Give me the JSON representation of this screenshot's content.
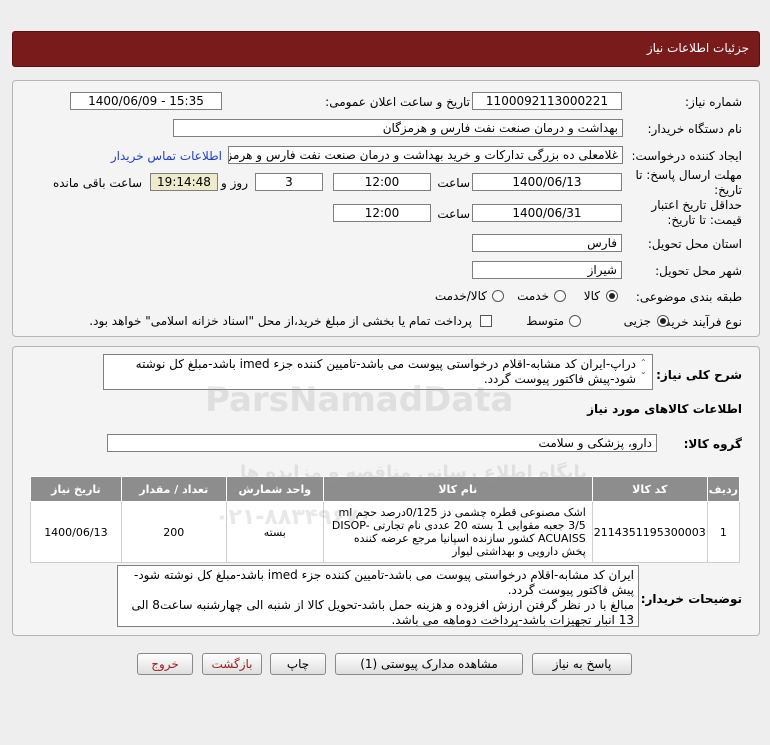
{
  "header": {
    "title": "جزئیات اطلاعات نیاز"
  },
  "form": {
    "need_number_label": "شماره نیاز:",
    "need_number": "1100092113000221",
    "announce_label": "تاریخ و ساعت اعلان عمومی:",
    "announce_value": "1400/06/09 - 15:35",
    "buyer_org_label": "نام دستگاه خریدار:",
    "buyer_org": "بهداشت و درمان صنعت نفت فارس و هرمزگان",
    "creator_label": "ایجاد کننده درخواست:",
    "creator": "غلامعلی ده بزرگی تدارکات و خرید بهداشت و درمان صنعت نفت فارس و هرمزگان",
    "contact_link": "اطلاعات تماس خریدار",
    "deadline_label": "مهلت ارسال پاسخ: تا تاریخ:",
    "deadline_date": "1400/06/13",
    "time_label": "ساعت",
    "deadline_time": "12:00",
    "days": "3",
    "days_label": "روز و",
    "remaining": "19:14:48",
    "remaining_label": "ساعت باقی مانده",
    "validity_label": "حداقل تاریخ اعتبار قیمت: تا تاریخ:",
    "validity_date": "1400/06/31",
    "validity_time": "12:00",
    "province_label": "استان محل تحویل:",
    "province": "فارس",
    "city_label": "شهر محل تحویل:",
    "city": "شیراز",
    "category_label": "طبقه بندی موضوعی:",
    "cat_goods": "کالا",
    "cat_service": "خدمت",
    "cat_both": "کالا/خدمت",
    "process_label": "نوع فرآیند خرید :",
    "proc_partial": "جزیی",
    "proc_medium": "متوسط",
    "proc_note": "پرداخت تمام یا بخشی از مبلغ خرید،از محل \"اسناد خزانه اسلامی\" خواهد بود."
  },
  "description": {
    "label": "شرح کلی نیاز:",
    "text": "دراپ-ایران کد مشابه-اقلام درخواستی پیوست می باشد-تامیین کننده جزء imed باشد-مبلغ کل نوشته شود-پیش فاکتور پیوست گردد."
  },
  "goods": {
    "section_title": "اطلاعات کالاهای مورد نیاز",
    "group_label": "گروه کالا:",
    "group_value": "دارو، پزشکی و سلامت",
    "columns": [
      "ردیف",
      "کد کالا",
      "نام کالا",
      "واحد شمارش",
      "تعداد / مقدار",
      "تاریخ نیاز"
    ],
    "rows": [
      {
        "row": "1",
        "code": "2114351195300003",
        "name": "اشک مصنوعی قطره چشمی دز 0/125درصد حجم ml 3/5 جعبه مقوایی 1 بسته 20 عددی نام تجارتی DISOP-ACUAISS کشور سازنده اسپانیا مرجع عرضه کننده پخش دارویی و بهداشتی لیوار",
        "unit": "بسته",
        "qty": "200",
        "date": "1400/06/13"
      }
    ]
  },
  "buyer_notes": {
    "label": "توضیحات خریدار:",
    "text": "ایران کد مشابه-اقلام درخواستی پیوست می باشد-تامیین کننده جزء imed باشد-مبلغ کل نوشته شود-پیش فاکتور پیوست گردد.\nمبالغ با در نظر گرفتن ارزش افزوده و هزینه حمل باشد-تحویل کالا از شنبه الی چهارشنبه ساعت8 الی 13 انبار تجهیزات باشد-پرداخت دوماهه می باشد."
  },
  "buttons": {
    "reply": "پاسخ به نیاز",
    "attachments": "مشاهده مدارک پیوستی (1)",
    "print": "چاپ",
    "back": "بازگشت",
    "exit": "خروج"
  },
  "watermark": {
    "brand": "ParsNamadData",
    "line1": "پایگاه اطلاع رسانی مناقصه و مزایده ها",
    "line2": "۰۲۱-۸۸۳۴۹۶۷۰"
  }
}
